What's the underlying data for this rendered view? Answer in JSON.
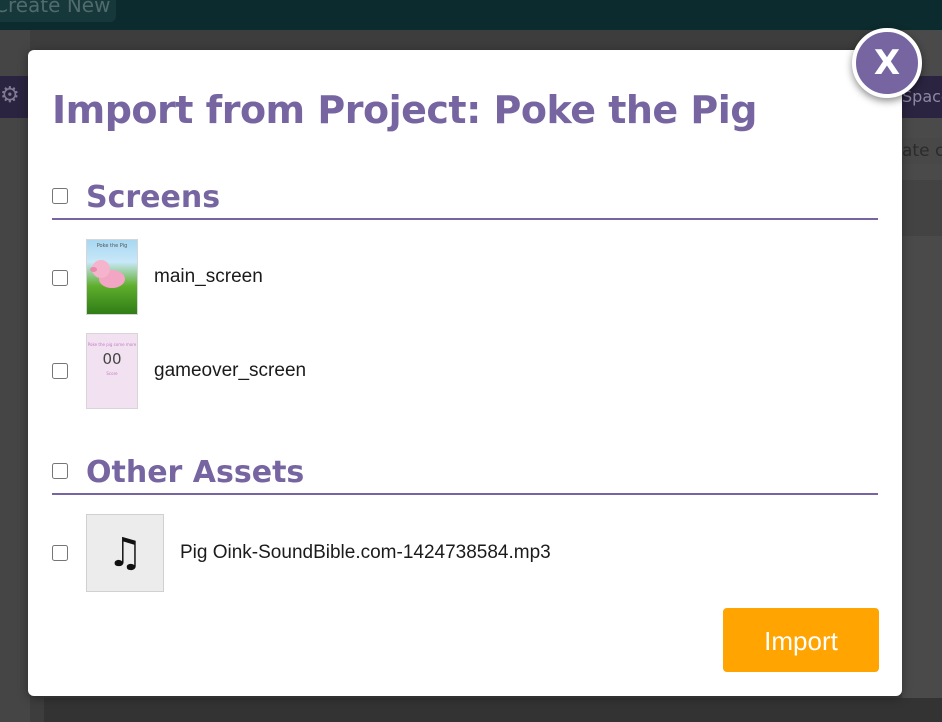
{
  "background": {
    "create_button_label": "Create New",
    "right_tab_label": "Space",
    "right_text": "ate c"
  },
  "modal": {
    "close_label": "X",
    "title": "Import from Project: Poke the Pig",
    "screens_section": {
      "title": "Screens",
      "items": [
        {
          "label": "main_screen",
          "thumb_title": "Poke the Pig",
          "thumb_subtitle": "Tap the pig to score"
        },
        {
          "label": "gameover_screen",
          "thumb_title": "Poke the pig some more",
          "thumb_score": "00",
          "thumb_small": "Score"
        }
      ]
    },
    "assets_section": {
      "title": "Other Assets",
      "items": [
        {
          "label": "Pig Oink-SoundBible.com-1424738584.mp3",
          "icon": "music-note-icon"
        }
      ]
    },
    "import_button_label": "Import"
  },
  "colors": {
    "accent_purple": "#7665a0",
    "import_orange": "#ffa400"
  }
}
